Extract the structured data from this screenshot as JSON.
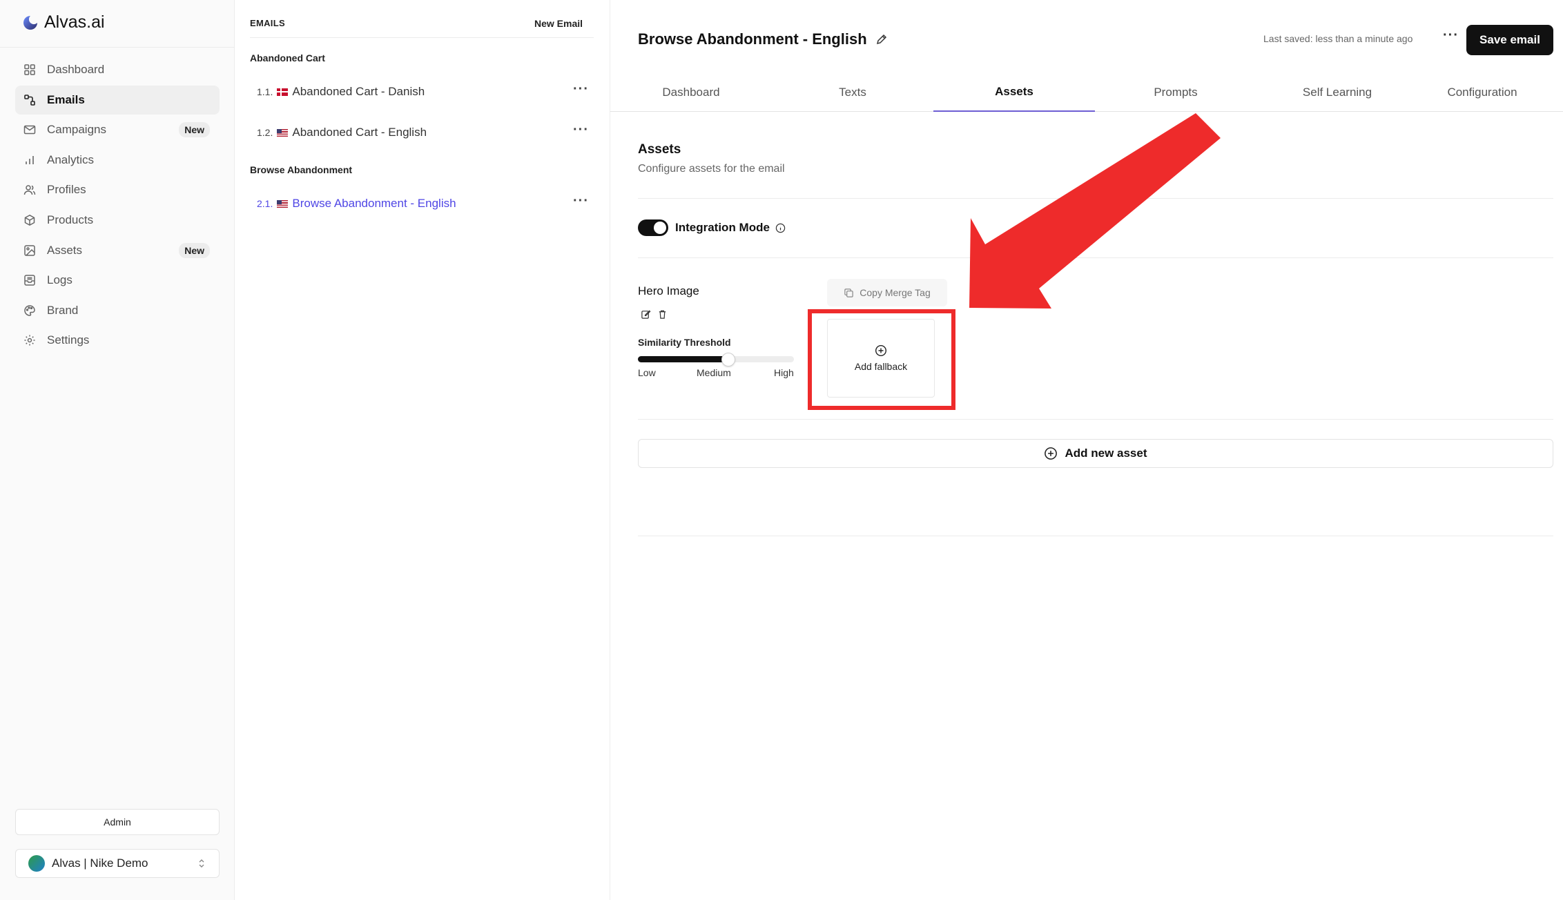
{
  "app": {
    "brand": "Alvas.ai"
  },
  "sidebar": {
    "items": [
      {
        "label": "Dashboard",
        "icon": "grid-icon",
        "active": false,
        "badge": ""
      },
      {
        "label": "Emails",
        "icon": "workflow-icon",
        "active": true,
        "badge": ""
      },
      {
        "label": "Campaigns",
        "icon": "mail-icon",
        "active": false,
        "badge": "New"
      },
      {
        "label": "Analytics",
        "icon": "bar-chart-icon",
        "active": false,
        "badge": ""
      },
      {
        "label": "Profiles",
        "icon": "users-icon",
        "active": false,
        "badge": ""
      },
      {
        "label": "Products",
        "icon": "package-icon",
        "active": false,
        "badge": ""
      },
      {
        "label": "Assets",
        "icon": "image-icon",
        "active": false,
        "badge": "New"
      },
      {
        "label": "Logs",
        "icon": "inbox-icon",
        "active": false,
        "badge": ""
      },
      {
        "label": "Brand",
        "icon": "palette-icon",
        "active": false,
        "badge": ""
      },
      {
        "label": "Settings",
        "icon": "gear-icon",
        "active": false,
        "badge": ""
      }
    ],
    "admin_label": "Admin",
    "workspace_name": "Alvas | Nike Demo"
  },
  "emails": {
    "title": "EMAILS",
    "new_email_label": "New Email",
    "groups": [
      {
        "title": "Abandoned Cart",
        "items": [
          {
            "num": "1.1.",
            "flag": "dk",
            "name": "Abandoned Cart - Danish",
            "active": false
          },
          {
            "num": "1.2.",
            "flag": "us",
            "name": "Abandoned Cart - English",
            "active": false
          }
        ]
      },
      {
        "title": "Browse Abandonment",
        "items": [
          {
            "num": "2.1.",
            "flag": "us",
            "name": "Browse Abandonment - English",
            "active": true
          }
        ]
      }
    ],
    "more_label": "···"
  },
  "main": {
    "title": "Browse Abandonment - English",
    "last_saved": "Last saved: less than a minute ago",
    "more_label": "···",
    "save_label": "Save email",
    "tabs": [
      "Dashboard",
      "Texts",
      "Assets",
      "Prompts",
      "Self Learning",
      "Configuration"
    ],
    "active_tab": "Assets",
    "section_title": "Assets",
    "section_desc": "Configure assets for the email",
    "integration_mode_label": "Integration Mode",
    "integration_mode_on": true,
    "asset": {
      "name": "Hero Image",
      "copy_merge_tag_label": "Copy Merge Tag",
      "similarity_label": "Similarity Threshold",
      "similarity_value": 0.58,
      "ticks": [
        "Low",
        "Medium",
        "High"
      ],
      "fallback_label": "Add fallback"
    },
    "add_asset_label": "Add new asset"
  },
  "colors": {
    "accent": "#4f46e5",
    "tab_underline": "#6d5dd3",
    "annotation": "#ee2b2b",
    "primary_button": "#111111"
  }
}
